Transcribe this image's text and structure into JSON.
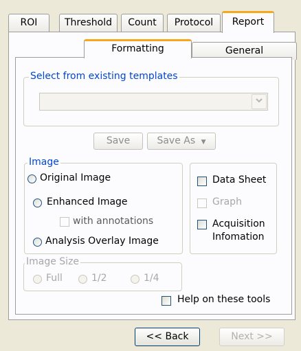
{
  "tabs": [
    "ROI",
    "Threshold",
    "Count",
    "Protocol",
    "Report"
  ],
  "active_tab": "Report",
  "subtabs": [
    "Formatting",
    "General"
  ],
  "templates": {
    "legend": "Select from existing templates",
    "selected_value": "",
    "save_label": "Save",
    "save_as_label": "Save As",
    "dropdown_arrow": "▼"
  },
  "image_group": {
    "legend": "Image",
    "options": [
      "Original Image",
      "Enhanced Image",
      "Analysis Overlay Image"
    ],
    "with_annotations": "with annotations"
  },
  "sheets": {
    "data_sheet": "Data Sheet",
    "graph": "Graph",
    "acquisition_line1": "Acquisition",
    "acquisition_line2": "Infomation"
  },
  "image_size": {
    "legend": "Image Size",
    "options": [
      "Full",
      "1/2",
      "1/4"
    ]
  },
  "help_label": "Help on these tools",
  "footer": {
    "back_label": "<< Back",
    "next_label": "Next >>"
  },
  "colors": {
    "accent": "#f6a81c",
    "group_title": "#0046d5",
    "disabled_text": "#a7a6aa"
  }
}
